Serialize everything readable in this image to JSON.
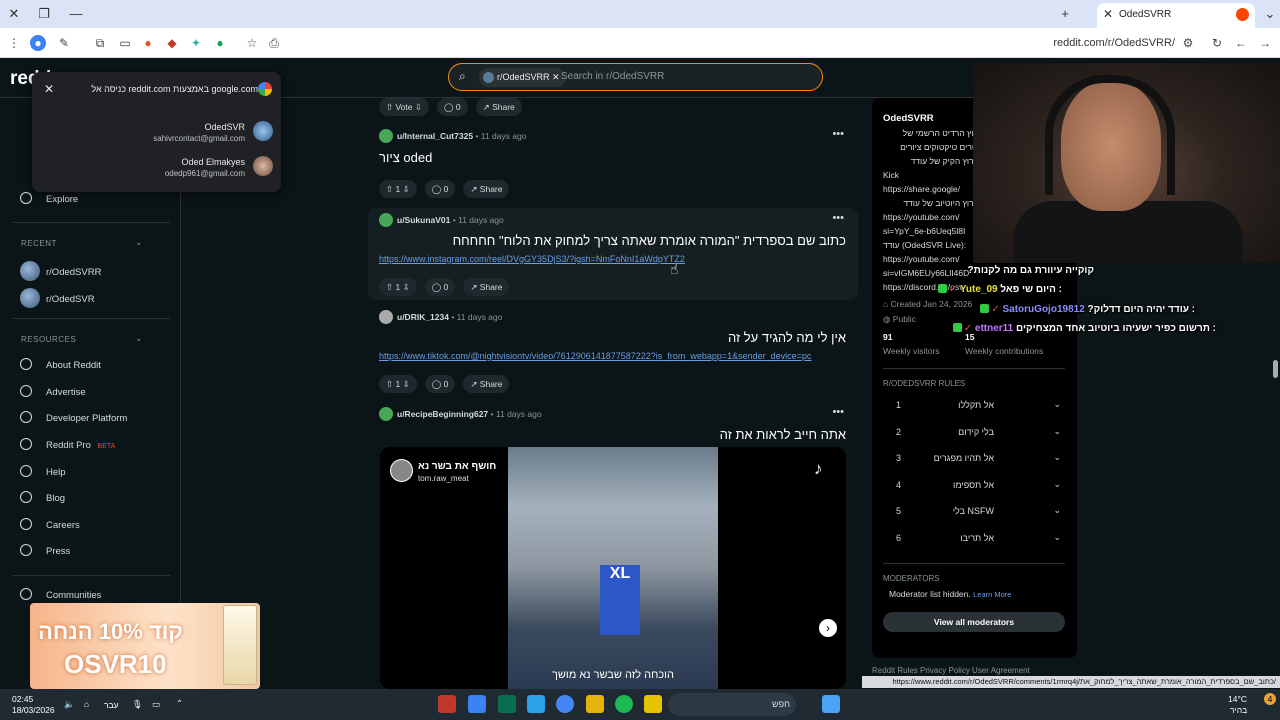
{
  "browser": {
    "tab_title": "OdedSVRR",
    "url": "reddit.com/r/OdedSVRR/"
  },
  "header": {
    "logo": "redd",
    "search_chip": "r/OdedSVRR",
    "search_placeholder": "Search in r/OdedSVRR"
  },
  "google_popup": {
    "title": "כניסה אל reddit.com באמצעות google.com",
    "accounts": [
      {
        "name": "OdedSVR",
        "email": "sahivrcontact@gmail.com"
      },
      {
        "name": "Oded Elmakyes",
        "email": "odedp961@gmail.com"
      }
    ]
  },
  "sidebar": {
    "explore": "Explore",
    "recent_header": "RECENT",
    "recent": [
      "r/OdedSVRR",
      "r/OdedSVR"
    ],
    "resources_header": "RESOURCES",
    "resources": [
      "About Reddit",
      "Advertise",
      "Developer Platform",
      "Reddit Pro",
      "Help",
      "Blog",
      "Careers",
      "Press"
    ],
    "pro_badge": "BETA",
    "communities": "Communities",
    "promo_line1": "קוד 10% הנחה",
    "promo_line2": "OSVR10"
  },
  "feed": {
    "top_actions": {
      "vote": "Vote",
      "comments": "0",
      "share": "Share"
    },
    "posts": [
      {
        "user": "u/Internal_Cut7325",
        "time": "• 11 days ago",
        "title": "ציור oded",
        "link": "",
        "votes": "1",
        "comments": "0",
        "share": "Share"
      },
      {
        "user": "u/SukunaV01",
        "time": "• 11 days ago",
        "title": "כתוב שם בספרדית \"המורה אומרת שאתה צריך למחוק את הלוח\" חחחחח",
        "link": "https://www.instagram.com/reel/DVgGY35DjS3/?igsh=NmFoNnI1aWdpYTZ2",
        "votes": "1",
        "comments": "0",
        "share": "Share"
      },
      {
        "user": "u/DRIK_1234",
        "time": "• 11 days ago",
        "title": "אין לי מה להגיד על זה",
        "link": "https://www.tiktok.com/@nightvisiontv/video/7612906141877587222?is_from_webapp=1&sender_device=pc",
        "votes": "1",
        "comments": "0",
        "share": "Share"
      },
      {
        "user": "u/RecipeBeginning627",
        "time": "• 11 days ago",
        "title": "אתה חייב לראות את זה",
        "link": "",
        "votes": "",
        "comments": "",
        "share": ""
      }
    ],
    "video": {
      "account_name": "חושף את בשר נא",
      "account_handle": "tom.raw_meat",
      "caption": "הוכחה לזה שבשר נא מושך",
      "sign": "XL"
    }
  },
  "right_sidebar": {
    "name": "OdedSVRR",
    "desc_lines": [
      "ערוץ הרדיט הרשמי של",
      "סטרים טיקטוקים ציורים",
      "לערוץ הקיק של עודד",
      "Kick",
      "https://share.google/",
      "לערוץ היוטיוב של עודד",
      "https://youtube.com/",
      "si=YpY_6e-b6Ueq5l8I",
      "עודד (OdedSVR Live):",
      "https://youtube.com/",
      "si=vIGM6EUy66LlI46D",
      "https://discord.gg/osv"
    ],
    "created": "Created Jan 24, 2026",
    "visibility": "Public",
    "visitors_value": "91",
    "visitors_label": "Weekly visitors",
    "contrib_value": "15",
    "contrib_label": "Weekly contributions",
    "rules_header": "R/ODEDSVRR RULES",
    "rules": [
      "אל תקללו",
      "בלי קידום",
      "אל תהיו מפגרים",
      "אל תספימו",
      "בלי NSFW",
      "אל תריבו"
    ],
    "mods_header": "MODERATORS",
    "mods_hidden": "Moderator list hidden.",
    "learn_more": "Learn More",
    "view_all_mods": "View all moderators",
    "footer": "Reddit Rules  Privacy Policy  User Agreement"
  },
  "chat": [
    {
      "user": "",
      "msg": "?קוקייה עיוורת גם מה לקנות",
      "color": "#ffffff"
    },
    {
      "user": "Yute_09",
      "msg": "היום שי פאל :",
      "color": "#e9e63a"
    },
    {
      "user": "SatoruGojo19812",
      "msg": "?עודד יהיה היום דדלוק :",
      "color": "#8b8cff"
    },
    {
      "user": "ettner11",
      "msg": "תרשום כפיר ישעיהו ביוטיוב אחד המצחיקים :",
      "color": "#c07bff"
    }
  ],
  "status_link": "https://www.reddit.com/r/OdedSVRR/comments/1rmrq4j/כתוב_שם_בספרדית_המורה_אומרת_שאתה_צריך_למחוק_את/",
  "taskbar": {
    "time": "02:45",
    "date": "18/03/2026",
    "lang": "עבר",
    "search": "חפש",
    "weather_temp": "14°C",
    "weather_desc": "בהיר",
    "notif": "4"
  }
}
